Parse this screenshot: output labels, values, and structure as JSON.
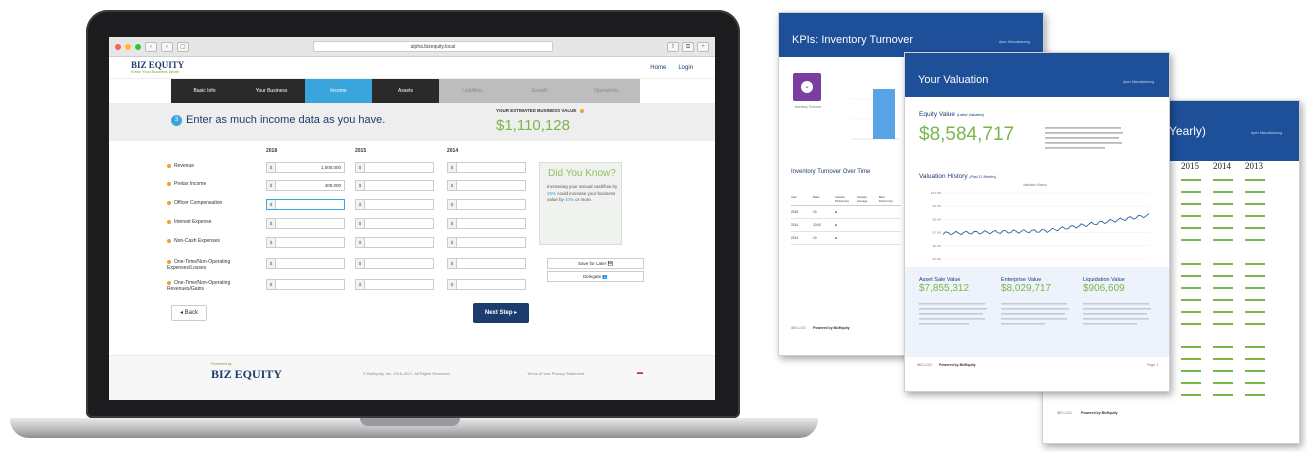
{
  "browser": {
    "url": "alpha.bizequity.local",
    "nav_back": "‹",
    "nav_forward": "›"
  },
  "site": {
    "logo": "BIZ EQUITY",
    "tagline": "Know Your Business Worth",
    "nav_links": [
      "Home",
      "Login"
    ]
  },
  "steps": [
    {
      "label": "Basic Info",
      "state": "dark"
    },
    {
      "label": "Your Business",
      "state": "dark"
    },
    {
      "label": "Income",
      "state": "active"
    },
    {
      "label": "Assets",
      "state": "dark"
    },
    {
      "label": "Liabilities",
      "state": "future"
    },
    {
      "label": "Growth",
      "state": "future"
    },
    {
      "label": "Operations",
      "state": "future"
    }
  ],
  "banner": {
    "step_number": "3",
    "title": "Enter as much income data as you have.",
    "estimate_label": "YOUR ESTIMATED BUSINESS VALUE",
    "estimate_value": "$1,110,128"
  },
  "form": {
    "years": [
      "2018",
      "2015",
      "2014"
    ],
    "currency": "$",
    "rows": [
      {
        "label": "Revenue",
        "values": [
          "1,000,000",
          "",
          ""
        ]
      },
      {
        "label": "Pretax Income",
        "values": [
          "400,000",
          "",
          ""
        ]
      },
      {
        "label": "Officer Compensation",
        "values": [
          "",
          "",
          ""
        ]
      },
      {
        "label": "Interest Expense",
        "values": [
          "",
          "",
          ""
        ]
      },
      {
        "label": "Non-Cash Expenses",
        "values": [
          "",
          "",
          ""
        ]
      },
      {
        "label": "One-Time/Non-Operating Expenses/Losses",
        "values": [
          "",
          "",
          ""
        ]
      },
      {
        "label": "One-Time/Non-Operating Revenues/Gains",
        "values": [
          "",
          "",
          ""
        ]
      }
    ]
  },
  "did_you_know": {
    "title": "Did You Know?",
    "text_a": "Increasing your annual cashflow by ",
    "highlight_a": "25%",
    "text_b": " could increase your business value by ",
    "highlight_b": "40%",
    "text_c": " or more."
  },
  "buttons": {
    "save_later": "Save for Later 💾",
    "delegate": "Delegate 👥",
    "back": "◂ Back",
    "next": "Next Step ▸"
  },
  "footer": {
    "powered_by": "Powered by",
    "logo": "BIZ EQUITY",
    "copyright": "© BizEquity, Inc. 2016-2017. All Rights Reserved.",
    "links": "Terms of Use   Privacy Statement",
    "flag": "▬"
  },
  "report_kpi": {
    "title": "KPIs: Inventory Turnover",
    "company": "Apex Manufacturing",
    "icon_caption": "Inventory Turnover",
    "section": "Inventory Turnover Over Time",
    "table_headers": [
      "Year",
      "Ratio",
      "Industry Performing",
      "Industry Average",
      "Best Performing"
    ],
    "table_years": [
      "2015",
      "2014",
      "2013"
    ],
    "table_ratios": [
      "10",
      "10.00",
      "10"
    ],
    "footer_left": "IBIS.LOG",
    "footer_mid": "Powered by BizEquity"
  },
  "report_valuation": {
    "title": "Your Valuation",
    "company": "Apex Manufacturing",
    "equity_label": "Equity Value",
    "equity_note": "(Latest Valuation)",
    "equity_value": "$8,584,717",
    "history_label": "Valuation History",
    "history_note": "(Past 12 Months)",
    "chart_title": "Valuation History",
    "chart_yticks": [
      "$10.0M",
      "$9.0M",
      "$8.0M",
      "$7.0M",
      "$6.0M",
      "$5.0M"
    ],
    "legend": "Valuation History",
    "metrics": [
      {
        "label": "Asset Sale Value",
        "value": "$7,855,312"
      },
      {
        "label": "Enterprise Value",
        "value": "$8,029,717"
      },
      {
        "label": "Liquidation Value",
        "value": "$906,609"
      }
    ],
    "footer_left": "IBIS.LOG",
    "footer_mid": "Powered by BizEquity",
    "footer_right": "Page 1"
  },
  "report_yearly": {
    "title": "(Yearly)",
    "company": "Apex Manufacturing",
    "years": [
      "2015",
      "2014",
      "2013"
    ],
    "footer_left": "IBIS.LOG",
    "footer_mid": "Powered by BizEquity"
  },
  "colors": {
    "brand_navy": "#1d3c6e",
    "accent_blue": "#3aa5dd",
    "value_green": "#7ab648",
    "report_header": "#1e4f99"
  }
}
